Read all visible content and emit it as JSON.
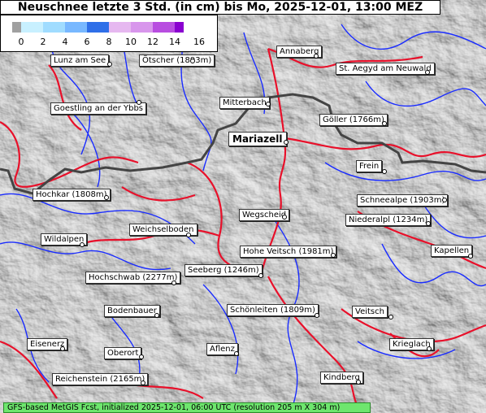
{
  "title": "Neuschnee letzte 3 Std. (in cm) bis Mo, 2025-12-01, 13:00 MEZ",
  "legend": {
    "ticks": [
      "0",
      "2",
      "4",
      "6",
      "8",
      "10",
      "12",
      "14",
      "16"
    ],
    "colors": [
      "#a0a0a0",
      "#c8f0ff",
      "#a0dcff",
      "#78b8ff",
      "#2f6fe8",
      "#e6b8f0",
      "#d896ec",
      "#b84de0",
      "#8a00d0"
    ]
  },
  "places": [
    {
      "name": "Lunz am See"
    },
    {
      "name": "Ötscher (1893m)"
    },
    {
      "name": "Annaberg"
    },
    {
      "name": "St. Aegyd am Neuwald"
    },
    {
      "name": "Goestling an der Ybbs"
    },
    {
      "name": "Mitterbach"
    },
    {
      "name": "Göller (1766m)"
    },
    {
      "name": "Mariazell"
    },
    {
      "name": "Frein"
    },
    {
      "name": "Hochkar (1808m)"
    },
    {
      "name": "Schneealpe (1903m)"
    },
    {
      "name": "Wegscheid"
    },
    {
      "name": "Niederalpl (1234m)"
    },
    {
      "name": "Weichselboden"
    },
    {
      "name": "Wildalpen"
    },
    {
      "name": "Hohe Veitsch (1981m)"
    },
    {
      "name": "Kapellen"
    },
    {
      "name": "Seeberg (1246m)"
    },
    {
      "name": "Hochschwab (2277m)"
    },
    {
      "name": "Bodenbauer"
    },
    {
      "name": "Schönleiten (1809m)"
    },
    {
      "name": "Veitsch"
    },
    {
      "name": "Eisenerz"
    },
    {
      "name": "Krieglach"
    },
    {
      "name": "Oberort"
    },
    {
      "name": "Aflenz"
    },
    {
      "name": "Kindberg"
    },
    {
      "name": "Reichenstein (2165m)"
    }
  ],
  "footer": "GFS-based MetGIS Fcst, initialized 2025-12-01, 06:00 UTC  (resolution 205 m X 304 m)"
}
